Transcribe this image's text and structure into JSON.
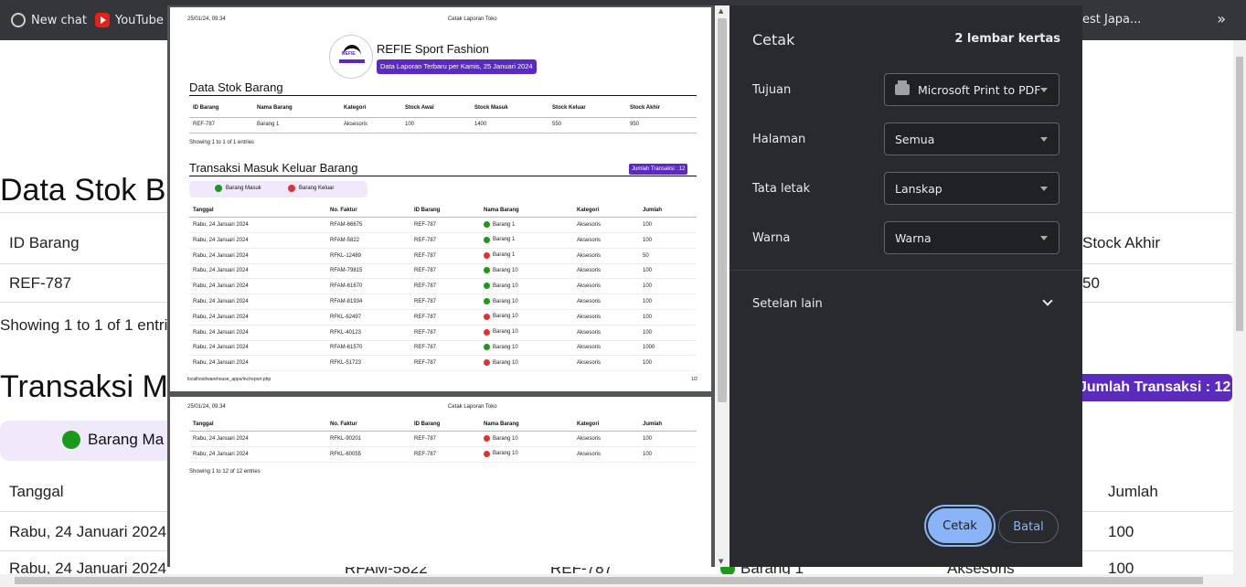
{
  "bookmarks": [
    {
      "label": "New chat",
      "icon": "chat-icon"
    },
    {
      "label": "YouTube",
      "icon": "youtube-icon"
    },
    {
      "label": "est Japa...",
      "icon": ""
    }
  ],
  "bookmarks_more": "»",
  "background_page": {
    "heading_stok": "Data Stok Ba",
    "col_id": "ID Barang",
    "row_id": "REF-787",
    "col_stock_akhir": "Stock Akhir",
    "row_stock_akhir": "50",
    "showing": "Showing 1 to 1 of 1 entrie",
    "heading_transaksi": "Transaksi M",
    "badge": "Jumlah Transaksi : 12",
    "legend_in": "Barang Ma",
    "col_tanggal": "Tanggal",
    "col_jumlah": "Jumlah",
    "row1_tanggal": "Rabu, 24 Januari 2024",
    "row1_jumlah": "100",
    "row2_tanggal": "Rabu, 24 Januari 2024",
    "row2_faktur": "RFAM-5822",
    "row2_id": "REF-787",
    "row2_nama": "Barang 1",
    "row2_kategori": "Aksesoris",
    "row2_jumlah": "100"
  },
  "preview": {
    "header_datetime": "25/01/24, 09.34",
    "header_title": "Cetak Laporan Toko",
    "logo_text": "REFIE",
    "brand": "REFIE Sport Fashion",
    "subtitle": "Data Laporan Terbaru per Kamis, 25 Januari 2024",
    "stok_heading": "Data Stok Barang",
    "stok_headers": [
      "ID Barang",
      "Nama Barang",
      "Kategori",
      "Stock Awal",
      "Stock Masuk",
      "Stock Keluar",
      "Stock Akhir"
    ],
    "stok_row": [
      "REF-787",
      "Barang 1",
      "Aksesoris",
      "100",
      "1400",
      "550",
      "950"
    ],
    "stok_showing": "Showing 1 to 1 of 1 entries",
    "trans_heading": "Transaksi Masuk Keluar Barang",
    "trans_badge": "Jumlah Transaksi : 12",
    "legend_in": "Barang Masuk",
    "legend_out": "Barang Keluar",
    "trans_headers": [
      "Tanggal",
      "No. Faktur",
      "ID Barang",
      "Nama Barang",
      "Kategori",
      "Jumlah"
    ],
    "trans_rows_page1": [
      {
        "tanggal": "Rabu, 24 Januari 2024",
        "faktur": "RFAM-66675",
        "id": "REF-787",
        "type": "in",
        "nama": "Barang 1",
        "kategori": "Aksesoris",
        "jumlah": "100"
      },
      {
        "tanggal": "Rabu, 24 Januari 2024",
        "faktur": "RFAM-5822",
        "id": "REF-787",
        "type": "in",
        "nama": "Barang 1",
        "kategori": "Aksesoris",
        "jumlah": "100"
      },
      {
        "tanggal": "Rabu, 24 Januari 2024",
        "faktur": "RFKL-12489",
        "id": "REF-787",
        "type": "out",
        "nama": "Barang 1",
        "kategori": "Aksesoris",
        "jumlah": "50"
      },
      {
        "tanggal": "Rabu, 24 Januari 2024",
        "faktur": "RFAM-79815",
        "id": "REF-787",
        "type": "in",
        "nama": "Barang 10",
        "kategori": "Aksesoris",
        "jumlah": "100"
      },
      {
        "tanggal": "Rabu, 24 Januari 2024",
        "faktur": "RFAM-61670",
        "id": "REF-787",
        "type": "in",
        "nama": "Barang 10",
        "kategori": "Aksesoris",
        "jumlah": "100"
      },
      {
        "tanggal": "Rabu, 24 Januari 2024",
        "faktur": "RFAM-81934",
        "id": "REF-787",
        "type": "in",
        "nama": "Barang 10",
        "kategori": "Aksesoris",
        "jumlah": "100"
      },
      {
        "tanggal": "Rabu, 24 Januari 2024",
        "faktur": "RFKL-62497",
        "id": "REF-787",
        "type": "out",
        "nama": "Barang 10",
        "kategori": "Aksesoris",
        "jumlah": "100"
      },
      {
        "tanggal": "Rabu, 24 Januari 2024",
        "faktur": "RFKL-40123",
        "id": "REF-787",
        "type": "out",
        "nama": "Barang 10",
        "kategori": "Aksesoris",
        "jumlah": "100"
      },
      {
        "tanggal": "Rabu, 24 Januari 2024",
        "faktur": "RFAM-61570",
        "id": "REF-787",
        "type": "in",
        "nama": "Barang 10",
        "kategori": "Aksesoris",
        "jumlah": "1000"
      },
      {
        "tanggal": "Rabu, 24 Januari 2024",
        "faktur": "RFKL-51723",
        "id": "REF-787",
        "type": "out",
        "nama": "Barang 10",
        "kategori": "Aksesoris",
        "jumlah": "100"
      }
    ],
    "footer_url": "localhost/warehouse_apps/inc/report.php",
    "footer_page": "1/2",
    "trans_rows_page2": [
      {
        "tanggal": "Rabu, 24 Januari 2024",
        "faktur": "RFKL-90201",
        "id": "REF-787",
        "type": "out",
        "nama": "Barang 10",
        "kategori": "Aksesoris",
        "jumlah": "100"
      },
      {
        "tanggal": "Rabu, 24 Januari 2024",
        "faktur": "RFKL-60055",
        "id": "REF-787",
        "type": "out",
        "nama": "Barang 10",
        "kategori": "Aksesoris",
        "jumlah": "100"
      }
    ],
    "trans_showing": "Showing 1 to 12 of 12 entries"
  },
  "dialog": {
    "title": "Cetak",
    "sheets": "2 lembar kertas",
    "destination_label": "Tujuan",
    "destination_value": "Microsoft Print to PDF",
    "pages_label": "Halaman",
    "pages_value": "Semua",
    "layout_label": "Tata letak",
    "layout_value": "Lanskap",
    "color_label": "Warna",
    "color_value": "Warna",
    "more_settings": "Setelan lain",
    "print_button": "Cetak",
    "cancel_button": "Batal"
  },
  "colors": {
    "accent_purple": "#5b2bbf",
    "dialog_bg": "#292a2d",
    "print_blue": "#8ab4f8",
    "in_green": "#1a9a1a",
    "out_red": "#e53030"
  }
}
